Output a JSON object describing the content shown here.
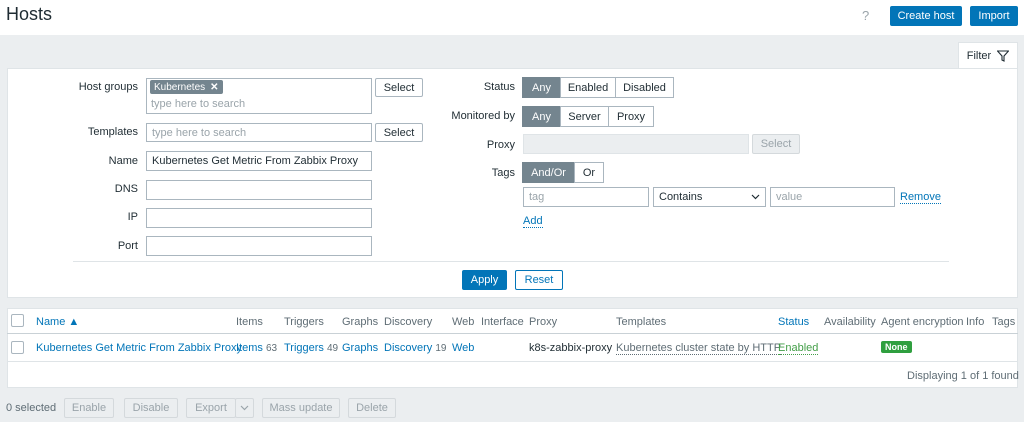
{
  "header": {
    "title": "Hosts",
    "help": "?",
    "create_host": "Create host",
    "import": "Import"
  },
  "filter": {
    "tab_label": "Filter",
    "host_groups_label": "Host groups",
    "host_group_chip": "Kubernetes",
    "host_groups_placeholder": "type here to search",
    "templates_label": "Templates",
    "templates_placeholder": "type here to search",
    "select_label": "Select",
    "name_label": "Name",
    "name_value": "Kubernetes Get Metric From Zabbix Proxy",
    "dns_label": "DNS",
    "ip_label": "IP",
    "port_label": "Port",
    "status_label": "Status",
    "status_options": [
      "Any",
      "Enabled",
      "Disabled"
    ],
    "monitored_by_label": "Monitored by",
    "monitored_options": [
      "Any",
      "Server",
      "Proxy"
    ],
    "proxy_label": "Proxy",
    "tags_label": "Tags",
    "tags_options": [
      "And/Or",
      "Or"
    ],
    "tag_placeholder": "tag",
    "tag_operator": "Contains",
    "value_placeholder": "value",
    "remove": "Remove",
    "add": "Add",
    "apply": "Apply",
    "reset": "Reset"
  },
  "table": {
    "columns": [
      "Name ▲",
      "Items",
      "Triggers",
      "Graphs",
      "Discovery",
      "Web",
      "Interface",
      "Proxy",
      "Templates",
      "Status",
      "Availability",
      "Agent encryption",
      "Info",
      "Tags"
    ],
    "row": {
      "name": "Kubernetes Get Metric From Zabbix Proxy",
      "items": "Items",
      "items_count": "63",
      "triggers": "Triggers",
      "triggers_count": "49",
      "graphs": "Graphs",
      "discovery": "Discovery",
      "discovery_count": "19",
      "web": "Web",
      "proxy": "k8s-zabbix-proxy",
      "templates": "Kubernetes cluster state by HTTP",
      "status": "Enabled",
      "encryption": "None"
    },
    "footer": "Displaying 1 of 1 found"
  },
  "bottom": {
    "selected": "0 selected",
    "enable": "Enable",
    "disable": "Disable",
    "export": "Export",
    "mass_update": "Mass update",
    "delete": "Delete"
  },
  "colors": {
    "accent": "#0275b8",
    "status_enabled": "#429e47",
    "badge_green": "#2f9f3f"
  }
}
